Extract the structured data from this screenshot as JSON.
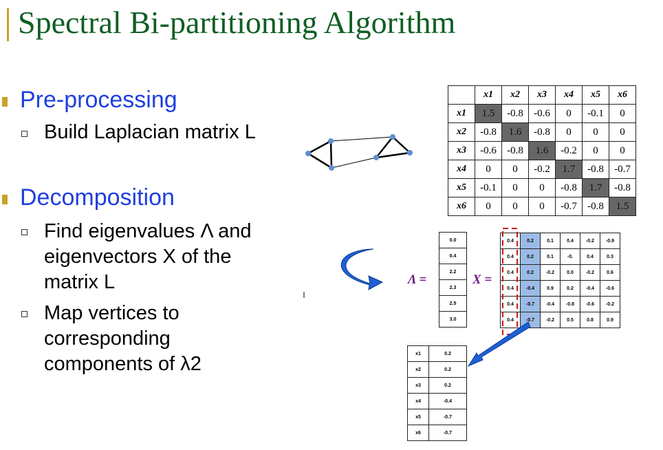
{
  "slide": {
    "title": "Spectral Bi-partitioning Algorithm"
  },
  "sections": [
    {
      "heading": "Pre-processing",
      "items": [
        "Build Laplacian matrix L"
      ]
    },
    {
      "heading": "Decomposition",
      "items": [
        [
          "Find eigenvalues Λ and",
          "eigenvectors X of the",
          "matrix L"
        ],
        [
          "Map vertices to",
          "corresponding",
          "components of λ2"
        ]
      ]
    }
  ],
  "laplacian": {
    "headers": [
      "x1",
      "x2",
      "x3",
      "x4",
      "x5",
      "x6"
    ],
    "rows": [
      [
        "1.5",
        "-0.8",
        "-0.6",
        "0",
        "-0.1",
        "0"
      ],
      [
        "-0.8",
        "1.6",
        "-0.8",
        "0",
        "0",
        "0"
      ],
      [
        "-0.6",
        "-0.8",
        "1.6",
        "-0.2",
        "0",
        "0"
      ],
      [
        "0",
        "0",
        "-0.2",
        "1.7",
        "-0.8",
        "-0.7"
      ],
      [
        "-0.1",
        "0",
        "0",
        "-0.8",
        "1.7",
        "-0.8"
      ],
      [
        "0",
        "0",
        "0",
        "-0.7",
        "-0.8",
        "1.5"
      ]
    ]
  },
  "eigen": {
    "lambda_label": "Λ =",
    "x_label": "X =",
    "lambda_values": [
      "0.0",
      "0.4",
      "2.2",
      "2.3",
      "2.5",
      "3.0"
    ],
    "x_rows": [
      [
        "0.4",
        "0.2",
        "0.1",
        "0.4",
        "-0.2",
        "-0.9"
      ],
      [
        "0.4",
        "0.2",
        "0.1",
        "-0.",
        "0.4",
        "0.3"
      ],
      [
        "0.4",
        "0.2",
        "-0.2",
        "0.0",
        "-0.2",
        "0.6"
      ],
      [
        "0.4",
        "-0.4",
        "0.9",
        "0.2",
        "-0.4",
        "-0.6"
      ],
      [
        "0.4",
        "-0.7",
        "-0.4",
        "-0.8",
        "-0.6",
        "-0.2"
      ],
      [
        "0.4",
        "-0.7",
        "-0.2",
        "0.5",
        "0.8",
        "0.9"
      ]
    ]
  },
  "vertex_map": {
    "rows": [
      {
        "k": "x1",
        "v": "0.2"
      },
      {
        "k": "x2",
        "v": "0.2"
      },
      {
        "k": "x3",
        "v": "0.2"
      },
      {
        "k": "x4",
        "v": "-0.4"
      },
      {
        "k": "x5",
        "v": "-0.7"
      },
      {
        "k": "x6",
        "v": "-0.7"
      }
    ]
  },
  "colors": {
    "title": "#0f5e24",
    "heading": "#1f3fe0",
    "bullet": "#c9a227",
    "highlight": "#9bbbe6",
    "arrow": "#1e5fd6"
  }
}
